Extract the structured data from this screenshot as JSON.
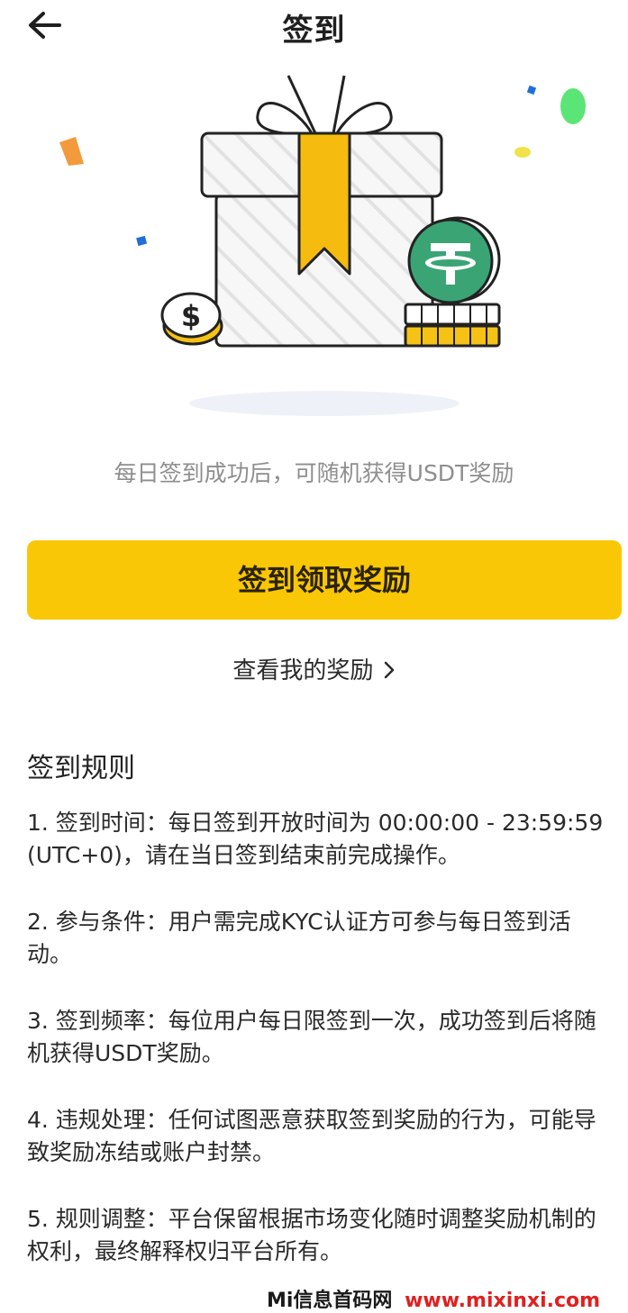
{
  "header": {
    "title": "签到",
    "back_icon": "arrow-left-icon"
  },
  "hero": {
    "illustration": "gift-box-with-coins",
    "coin_left_symbol": "$",
    "colors": {
      "ribbon": "#f5bb0f",
      "tether": "#3aa474",
      "coin_gold": "#f6c215"
    }
  },
  "subtitle": "每日签到成功后，可随机获得USDT奖励",
  "claim_button": {
    "label": "签到领取奖励",
    "color": "#f9c705"
  },
  "rewards_link": {
    "label": "查看我的奖励",
    "icon": "chevron-right-icon"
  },
  "rules": {
    "title": "签到规则",
    "items": [
      "1. 签到时间：每日签到开放时间为 00:00:00 - 23:59:59 (UTC+0)，请在当日签到结束前完成操作。",
      "2. 参与条件：用户需完成KYC认证方可参与每日签到活动。",
      "3. 签到频率：每位用户每日限签到一次，成功签到后将随机获得USDT奖励。",
      "4. 违规处理：任何试图恶意获取签到奖励的行为，可能导致奖励冻结或账户封禁。",
      "5. 规则调整：平台保留根据市场变化随时调整奖励机制的权利，最终解释权归平台所有。"
    ]
  },
  "watermark": {
    "text_cn": "Mi信息首码网",
    "url": "www.mixinxi.com"
  }
}
